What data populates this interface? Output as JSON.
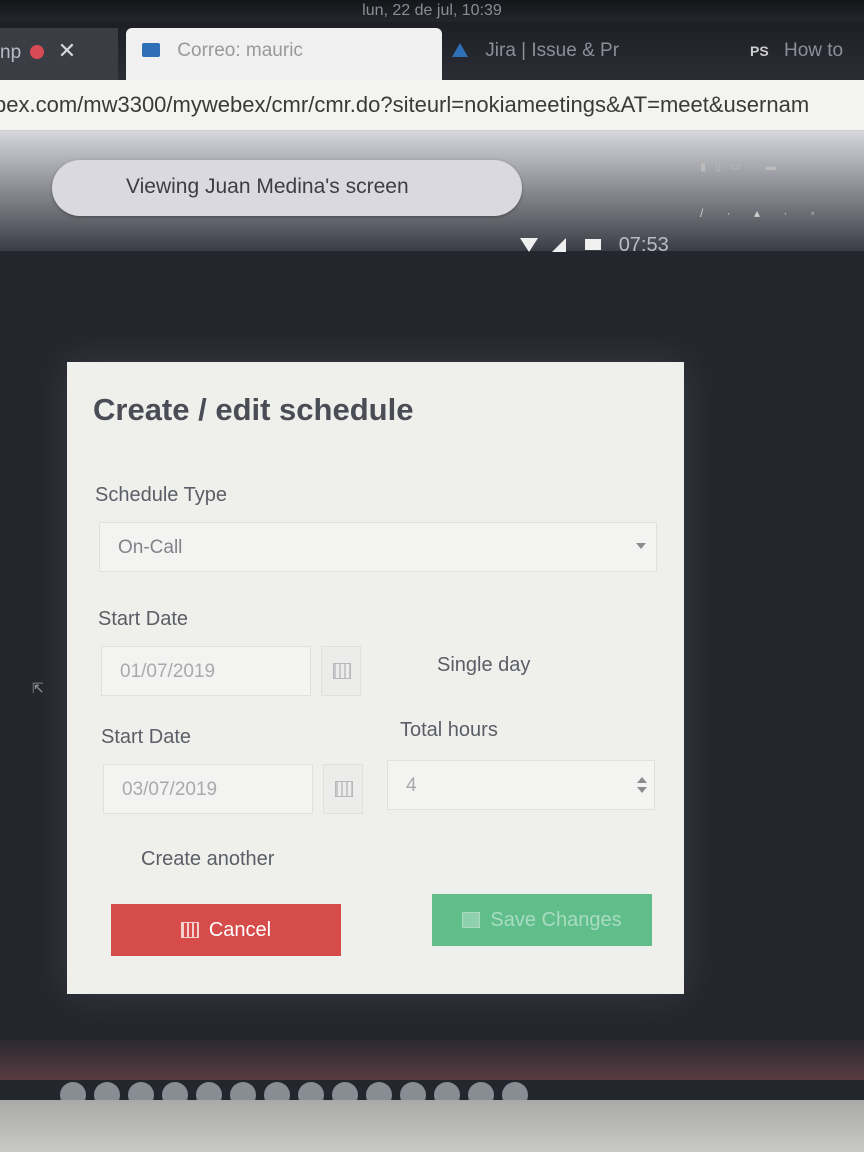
{
  "system": {
    "datetime": "lun, 22 de jul, 10:39"
  },
  "tabs": [
    {
      "label": "np",
      "close": "✕"
    },
    {
      "label": "Correo: mauric"
    },
    {
      "label": "Jira | Issue & Pr"
    },
    {
      "badge": "PS",
      "label": "How to"
    }
  ],
  "address_bar": {
    "url": "bex.com/mw3300/mywebex/cmr/cmr.do?siteurl=nokiameetings&AT=meet&usernam"
  },
  "webex": {
    "viewing_label": "Viewing Juan Medina's screen"
  },
  "remote_status": {
    "time": "07:53"
  },
  "dialog": {
    "title": "Create / edit schedule",
    "schedule_type": {
      "label": "Schedule Type",
      "value": "On-Call"
    },
    "start_date": {
      "label": "Start Date",
      "value": "01/07/2019"
    },
    "single_day_label": "Single day",
    "end_date": {
      "label": "Start Date",
      "value": "03/07/2019"
    },
    "total_hours": {
      "label": "Total hours",
      "value": "4"
    },
    "create_another_label": "Create another",
    "cancel_label": "Cancel",
    "save_label": "Save Changes"
  },
  "colors": {
    "cancel": "#d64c4a",
    "save": "#5fbe8a",
    "dialog_bg": "#efefec",
    "title": "#4a4d55"
  }
}
